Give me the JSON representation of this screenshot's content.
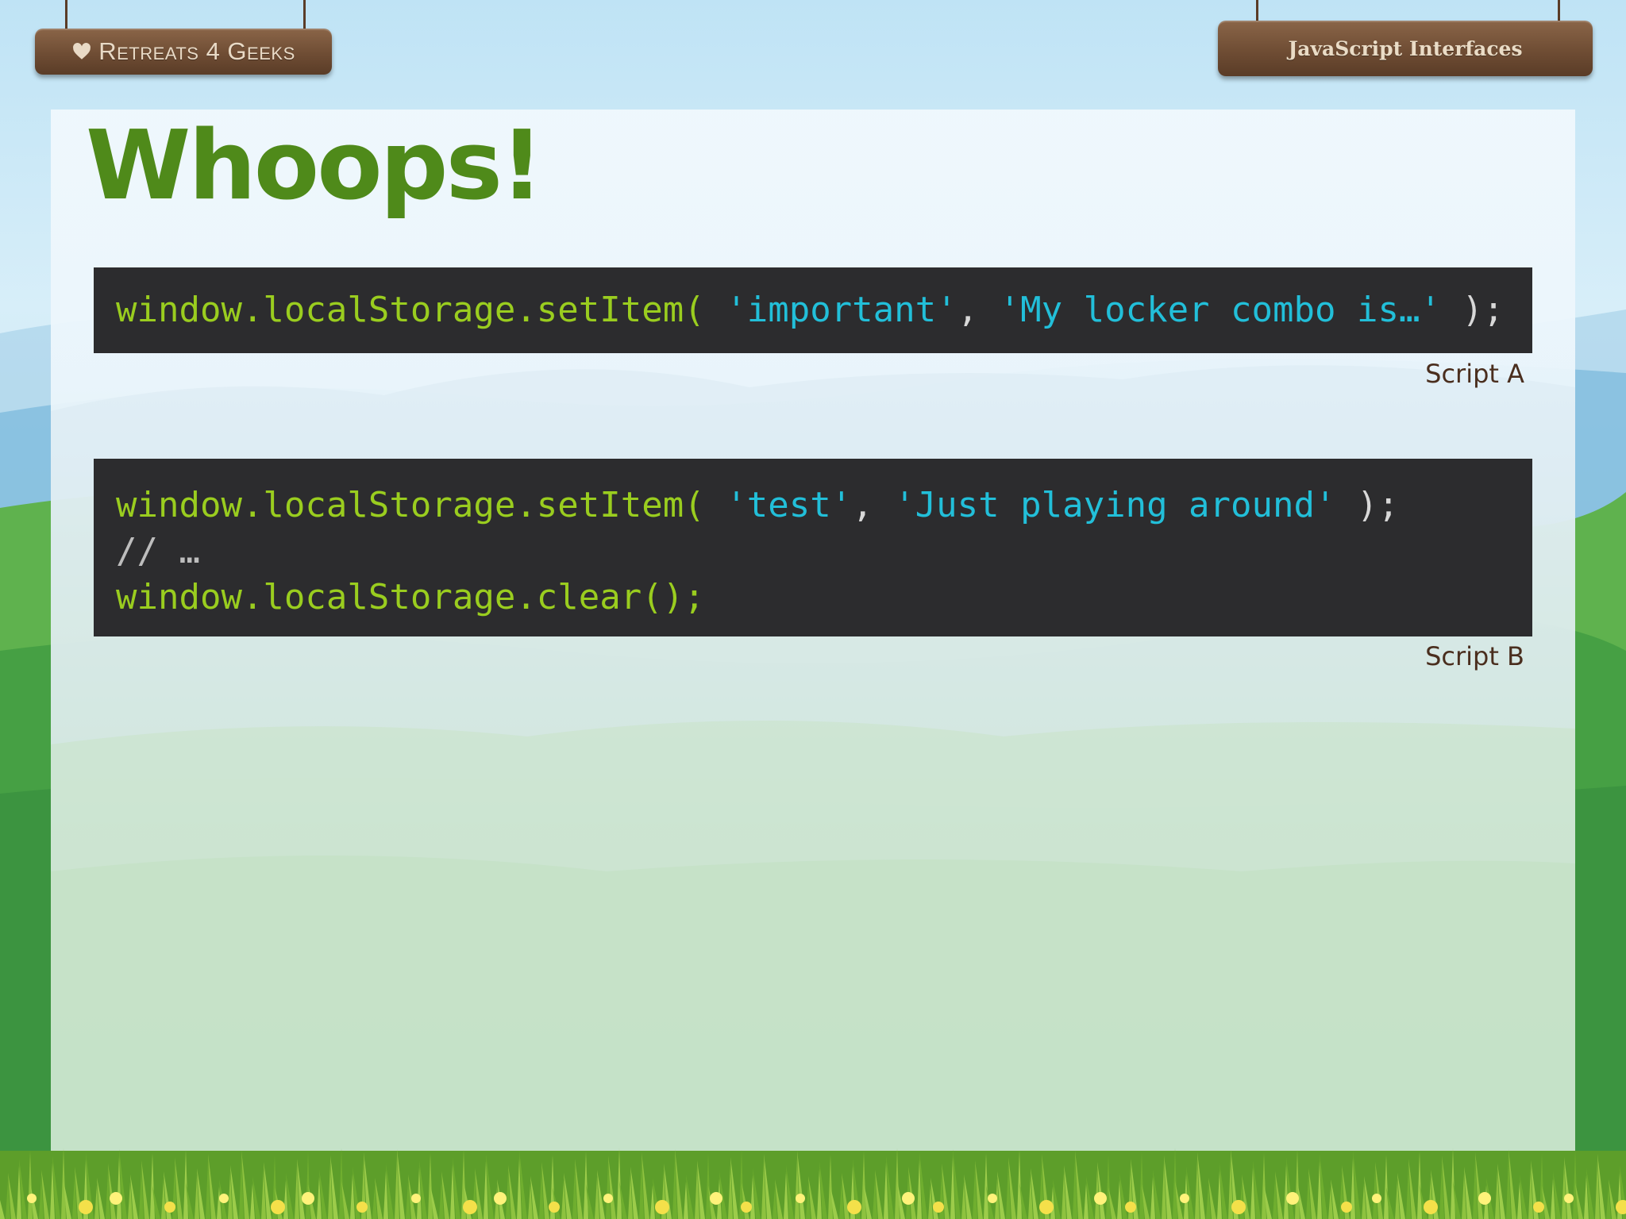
{
  "header": {
    "logo_text": "Retreats 4 Geeks",
    "topic": "JavaScript Interfaces"
  },
  "slide": {
    "title": "Whoops!",
    "script_a": {
      "call": "window.localStorage.setItem(",
      "arg1": "'important'",
      "sep": ",",
      "arg2": "'My locker combo is…'",
      "close": ");",
      "caption": "Script A"
    },
    "script_b": {
      "line1_call": "window.localStorage.setItem(",
      "line1_arg1": "'test'",
      "line1_sep": ",",
      "line1_arg2": "'Just playing around'",
      "line1_close": ");",
      "line2_comment": "// …",
      "line3_call": "window.localStorage.clear",
      "line3_close": "();",
      "caption": "Script B"
    }
  },
  "colors": {
    "title": "#4f8a1a",
    "code_background": "#2c2c2e",
    "code_keyword": "#9acd1f",
    "code_string": "#22bfd9",
    "caption": "#4a2e1e",
    "sign_wood": "#6f4d34"
  },
  "icons": {
    "logo": "heart-icon"
  }
}
